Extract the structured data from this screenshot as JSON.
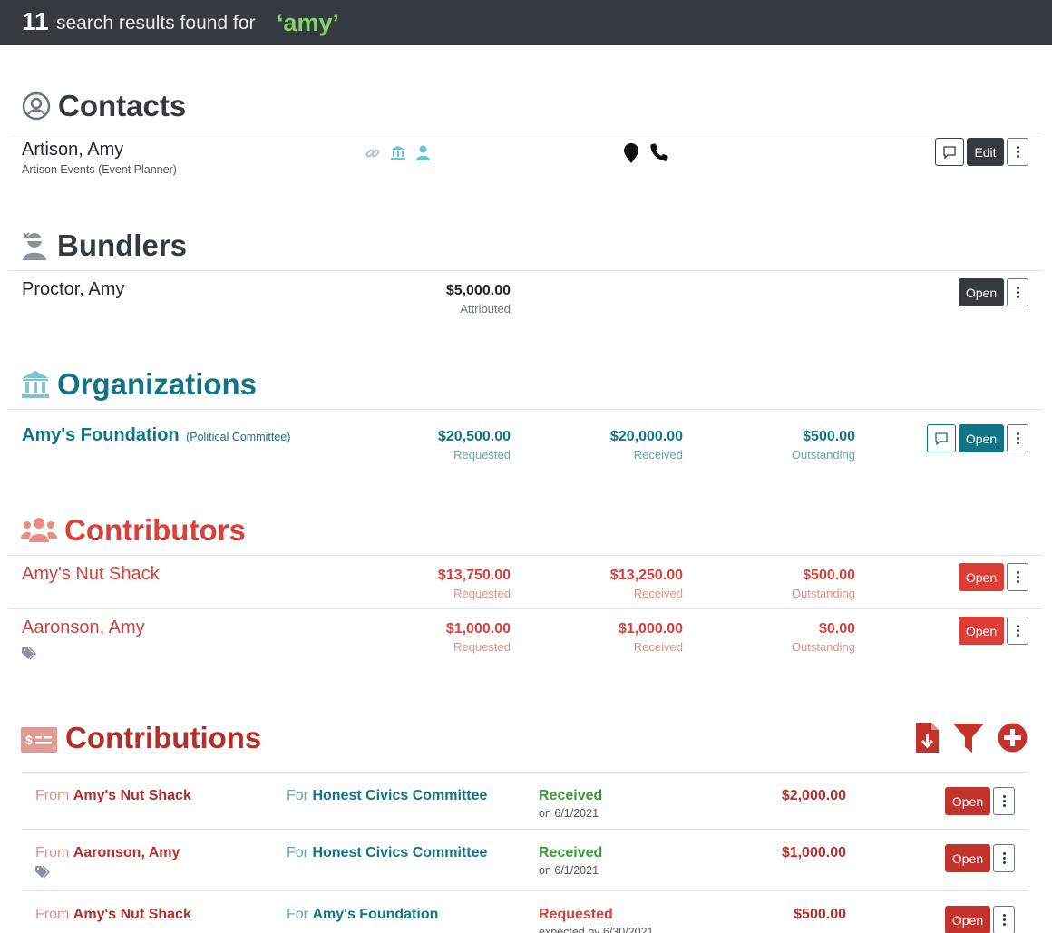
{
  "header": {
    "count": "11",
    "text": "search results found for",
    "term": "‘amy’"
  },
  "contacts": {
    "title": "Contacts",
    "item": {
      "name": "Artison, Amy",
      "subtitle": "Artison Events (Event Planner)",
      "edit_label": "Edit"
    }
  },
  "bundlers": {
    "title": "Bundlers",
    "item": {
      "name": "Proctor, Amy",
      "amount": "$5,000.00",
      "amount_label": "Attributed",
      "open_label": "Open"
    }
  },
  "organizations": {
    "title": "Organizations",
    "item": {
      "name": "Amy's Foundation",
      "type": "(Political Committee)",
      "requested": "$20,500.00",
      "requested_label": "Requested",
      "received": "$20,000.00",
      "received_label": "Received",
      "outstanding": "$500.00",
      "outstanding_label": "Outstanding",
      "open_label": "Open"
    }
  },
  "contributors": {
    "title": "Contributors",
    "items": [
      {
        "name": "Amy's Nut Shack",
        "requested": "$13,750.00",
        "requested_label": "Requested",
        "received": "$13,250.00",
        "received_label": "Received",
        "outstanding": "$500.00",
        "outstanding_label": "Outstanding",
        "open_label": "Open"
      },
      {
        "name": "Aaronson, Amy",
        "requested": "$1,000.00",
        "requested_label": "Requested",
        "received": "$1,000.00",
        "received_label": "Received",
        "outstanding": "$0.00",
        "outstanding_label": "Outstanding",
        "open_label": "Open"
      }
    ]
  },
  "contributions": {
    "title": "Contributions",
    "rows": [
      {
        "from_label": "From",
        "from": "Amy's Nut Shack",
        "for_label": "For",
        "for": "Honest Civics Committee",
        "status": "Received",
        "date": "on 6/1/2021",
        "amount": "$2,000.00",
        "open_label": "Open"
      },
      {
        "from_label": "From",
        "from": "Aaronson, Amy",
        "for_label": "For",
        "for": "Honest Civics Committee",
        "status": "Received",
        "date": "on 6/1/2021",
        "amount": "$1,000.00",
        "open_label": "Open"
      },
      {
        "from_label": "From",
        "from": "Amy's Nut Shack",
        "for_label": "For",
        "for": "Amy's Foundation",
        "status": "Requested",
        "date": "expected by 6/30/2021",
        "amount": "$500.00",
        "open_label": "Open"
      }
    ]
  },
  "colors": {
    "topbar": "#343a40",
    "term": "#86d36b",
    "teal": "#117485",
    "red": "#d9403a",
    "maroon": "#b3302a",
    "green": "#3a9a36"
  }
}
